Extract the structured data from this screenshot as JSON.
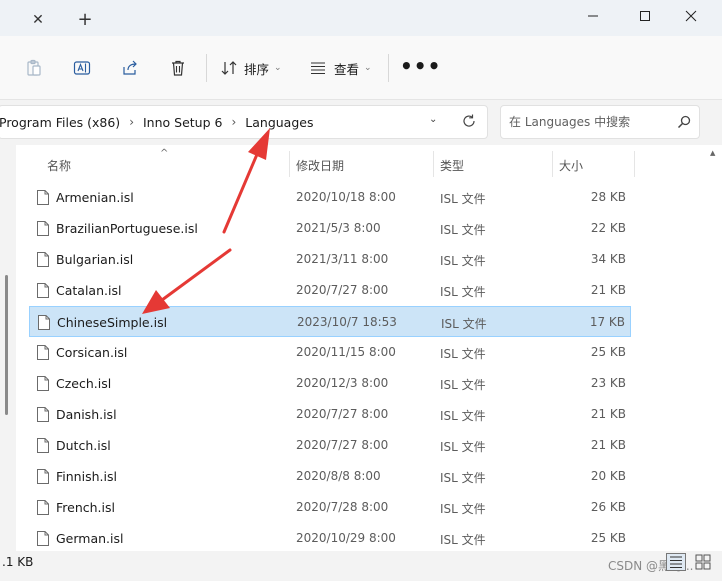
{
  "titlebar": {
    "close_tab": "✕",
    "new_tab": "+"
  },
  "toolbar": {
    "sort_label": "排序",
    "view_label": "查看",
    "more_label": "•••"
  },
  "address": {
    "crumbs": [
      "Program Files (x86)",
      "Inno Setup 6",
      "Languages"
    ],
    "separator": "›"
  },
  "search": {
    "placeholder": "在 Languages 中搜索"
  },
  "columns": {
    "name": "名称",
    "date": "修改日期",
    "type": "类型",
    "size": "大小"
  },
  "files": [
    {
      "name": "Armenian.isl",
      "date": "2020/10/18 8:00",
      "type": "ISL 文件",
      "size": "28 KB"
    },
    {
      "name": "BrazilianPortuguese.isl",
      "date": "2021/5/3 8:00",
      "type": "ISL 文件",
      "size": "22 KB"
    },
    {
      "name": "Bulgarian.isl",
      "date": "2021/3/11 8:00",
      "type": "ISL 文件",
      "size": "34 KB"
    },
    {
      "name": "Catalan.isl",
      "date": "2020/7/27 8:00",
      "type": "ISL 文件",
      "size": "21 KB"
    },
    {
      "name": "ChineseSimple.isl",
      "date": "2023/10/7 18:53",
      "type": "ISL 文件",
      "size": "17 KB"
    },
    {
      "name": "Corsican.isl",
      "date": "2020/11/15 8:00",
      "type": "ISL 文件",
      "size": "25 KB"
    },
    {
      "name": "Czech.isl",
      "date": "2020/12/3 8:00",
      "type": "ISL 文件",
      "size": "23 KB"
    },
    {
      "name": "Danish.isl",
      "date": "2020/7/27 8:00",
      "type": "ISL 文件",
      "size": "21 KB"
    },
    {
      "name": "Dutch.isl",
      "date": "2020/7/27 8:00",
      "type": "ISL 文件",
      "size": "21 KB"
    },
    {
      "name": "Finnish.isl",
      "date": "2020/8/8 8:00",
      "type": "ISL 文件",
      "size": "20 KB"
    },
    {
      "name": "French.isl",
      "date": "2020/7/28 8:00",
      "type": "ISL 文件",
      "size": "26 KB"
    },
    {
      "name": "German.isl",
      "date": "2020/10/29 8:00",
      "type": "ISL 文件",
      "size": "25 KB"
    }
  ],
  "selected_index": 4,
  "status": {
    "text": ".1 KB",
    "watermark": "CSDN @黑马..."
  },
  "colors": {
    "selection_bg": "#cce4f7",
    "selection_border": "#99d1ff",
    "annotation_arrow": "#e53935"
  }
}
